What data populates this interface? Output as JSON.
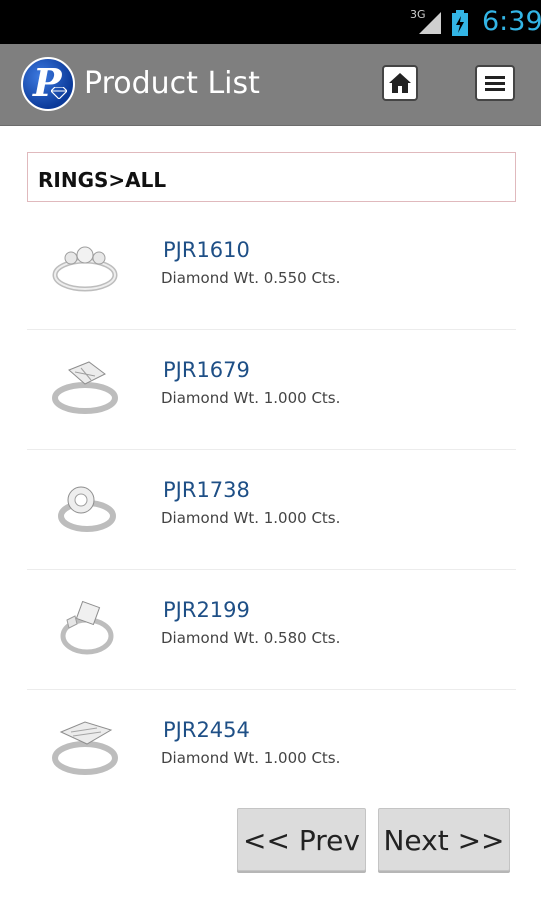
{
  "status": {
    "network": "3G",
    "time": "6:39"
  },
  "header": {
    "title": "Product List",
    "logo_letter": "P",
    "home_icon": "home-icon",
    "menu_icon": "menu-icon"
  },
  "category": {
    "label": "RINGS>ALL"
  },
  "products": [
    {
      "code": "PJR1610",
      "detail": "Diamond Wt. 0.550 Cts."
    },
    {
      "code": "PJR1679",
      "detail": "Diamond Wt. 1.000 Cts."
    },
    {
      "code": "PJR1738",
      "detail": "Diamond Wt. 1.000 Cts."
    },
    {
      "code": "PJR2199",
      "detail": "Diamond Wt. 0.580 Cts."
    },
    {
      "code": "PJR2454",
      "detail": "Diamond Wt. 1.000 Cts."
    }
  ],
  "pager": {
    "prev_label": "<< Prev",
    "next_label": "Next >>"
  }
}
